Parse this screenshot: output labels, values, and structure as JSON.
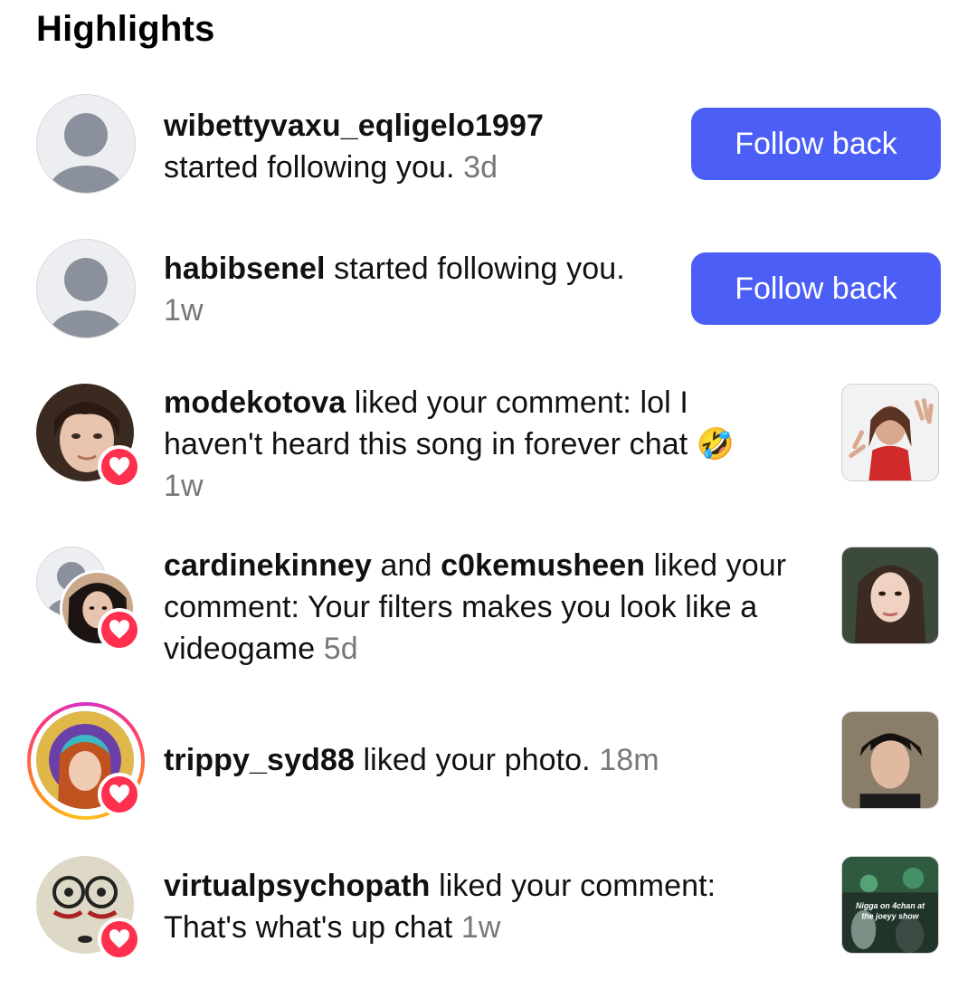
{
  "section": {
    "title": "Highlights"
  },
  "notifications": [
    {
      "user": "wibettyvaxu_eqligelo1997",
      "line2": "started following you.",
      "time": "3d",
      "button": "Follow back"
    },
    {
      "user": "habibsenel",
      "action": " started following you.",
      "time": "1w",
      "button": "Follow back"
    },
    {
      "user": "modekotova",
      "action_line1": " liked your comment: lol I",
      "action_line2": "haven't heard this song in forever chat ",
      "emoji": "🤣",
      "time": "1w"
    },
    {
      "user": "cardinekinney",
      "conj": " and ",
      "user2": "c0kemusheen",
      "action_line1": " liked your",
      "action_line2": "comment: Your filters makes you look like a",
      "action_line3": "videogame ",
      "time": "5d"
    },
    {
      "user": "trippy_syd88",
      "action": " liked your photo. ",
      "time": "18m"
    },
    {
      "user": "virtualpsychopath",
      "action_line1": " liked your comment:",
      "action_line2": "That's what's up chat ",
      "time": "1w",
      "thumb_caption_1": "Nigga on 4chan at",
      "thumb_caption_2": "the joeyy show"
    }
  ],
  "colors": {
    "accent": "#4b5ef5",
    "heart": "#ff2f4e",
    "time": "#787878"
  }
}
